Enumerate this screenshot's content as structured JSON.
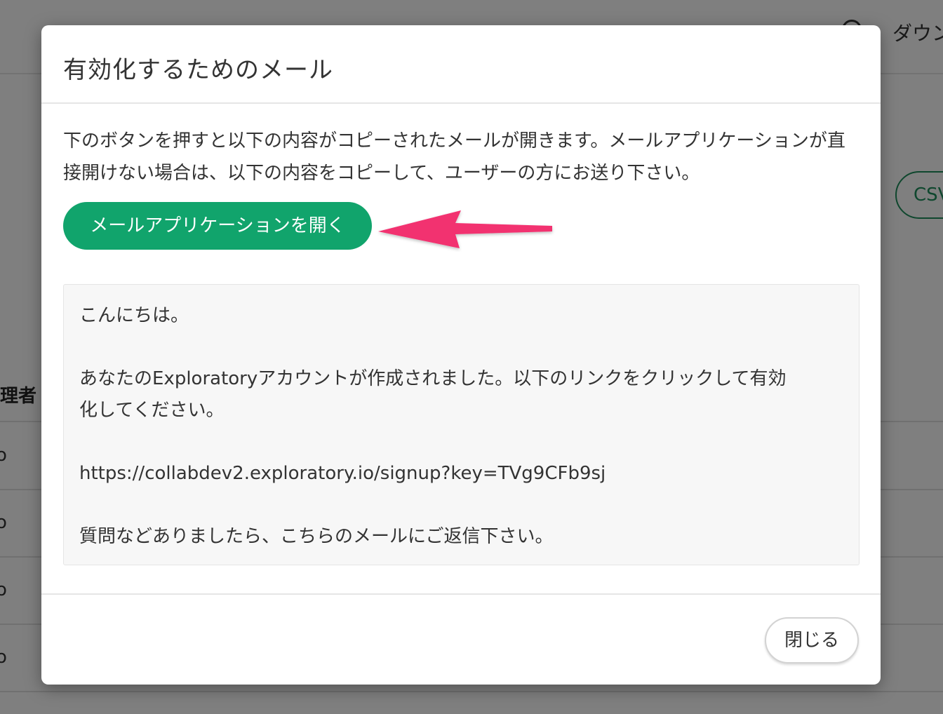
{
  "background": {
    "download_label": "ダウン",
    "csv_button_label": "CSV",
    "column_header": "理者",
    "row_text": "o"
  },
  "modal": {
    "title": "有効化するためのメール",
    "instructions": "下のボタンを押すと以下の内容がコピーされたメールが開きます。メールアプリケーションが直接開けない場合は、以下の内容をコピーして、ユーザーの方にお送り下さい。",
    "open_mail_button": "メールアプリケーションを開く",
    "message": {
      "greeting": "こんにちは。",
      "body_line1": "あなたのExploratoryアカウントが作成されました。以下のリンクをクリックして有効",
      "body_line2": "化してください。",
      "link": "https://collabdev2.exploratory.io/signup?key=TVg9CFb9sj",
      "closing": "質問などありましたら、こちらのメールにご返信下さい。"
    },
    "close_button": "閉じる"
  },
  "colors": {
    "accent_green": "#11a46c",
    "arrow_pink": "#f2306f"
  }
}
